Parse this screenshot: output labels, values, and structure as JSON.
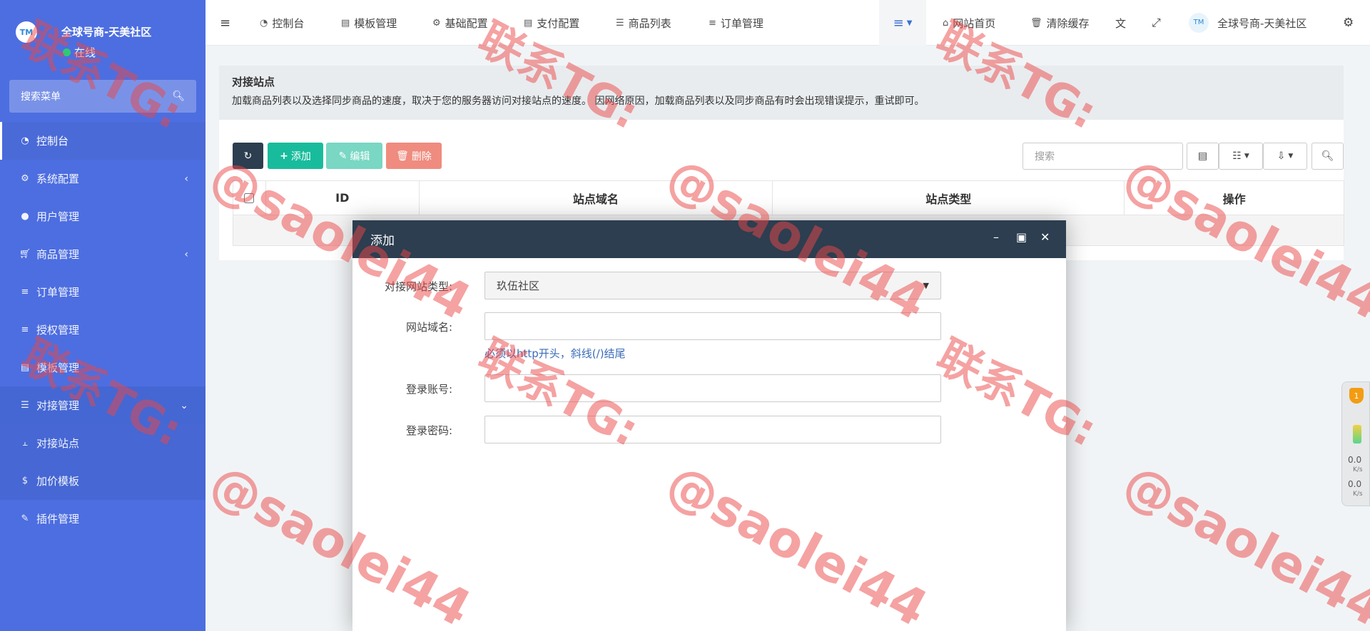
{
  "brand": {
    "name": "全球号商-天美社区",
    "status": "在线",
    "logo_text": "TM"
  },
  "sidebar": {
    "search_placeholder": "搜索菜单",
    "items": [
      {
        "label": "控制台",
        "icon": "dashboard-icon"
      },
      {
        "label": "系统配置",
        "icon": "gear-icon"
      },
      {
        "label": "用户管理",
        "icon": "user-icon"
      },
      {
        "label": "商品管理",
        "icon": "cart-icon"
      },
      {
        "label": "订单管理",
        "icon": "list-icon"
      },
      {
        "label": "授权管理",
        "icon": "list-icon"
      },
      {
        "label": "模板管理",
        "icon": "template-icon"
      },
      {
        "label": "对接管理",
        "icon": "sliders-icon"
      },
      {
        "label": "对接站点",
        "icon": "sitemap-icon"
      },
      {
        "label": "加价模板",
        "icon": "dollar-icon"
      },
      {
        "label": "插件管理",
        "icon": "plugin-icon"
      }
    ]
  },
  "topnav": {
    "items": [
      {
        "label": "控制台"
      },
      {
        "label": "模板管理"
      },
      {
        "label": "基础配置"
      },
      {
        "label": "支付配置"
      },
      {
        "label": "商品列表"
      },
      {
        "label": "订单管理"
      }
    ],
    "right": {
      "home": "网站首页",
      "clear_cache": "清除缓存",
      "site_name": "全球号商-天美社区"
    }
  },
  "notice": {
    "title": "对接站点",
    "text": "加载商品列表以及选择同步商品的速度，取决于您的服务器访问对接站点的速度。 因网络原因，加载商品列表以及同步商品有时会出现错误提示，重试即可。"
  },
  "toolbar": {
    "add": "添加",
    "edit": "编辑",
    "delete": "删除",
    "search_placeholder": "搜索"
  },
  "table": {
    "columns": [
      "ID",
      "站点域名",
      "站点类型",
      "操作"
    ]
  },
  "modal": {
    "title": "添加",
    "fields": {
      "site_type_label": "对接网站类型:",
      "site_type_value": "玖伍社区",
      "domain_label": "网站域名:",
      "domain_help": "必须以http开头，斜线(/)结尾",
      "account_label": "登录账号:",
      "password_label": "登录密码:"
    }
  },
  "speed": {
    "badge": "1",
    "up": "0.0",
    "down": "0.0",
    "unit": "K/s"
  },
  "watermark": {
    "line1": "联系TG:",
    "line2": "@saolei44"
  }
}
